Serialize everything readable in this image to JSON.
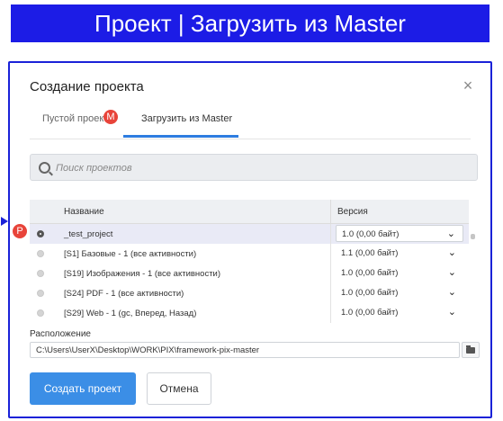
{
  "banner": {
    "title": "Проект | Загрузить из Master"
  },
  "dialog": {
    "title": "Создание проекта",
    "close_icon": "×",
    "tabs": [
      {
        "label": "Пустой проект",
        "active": false
      },
      {
        "label": "Загрузить из Master",
        "active": true,
        "marker": "M"
      }
    ],
    "search": {
      "placeholder": "Поиск проектов",
      "value": ""
    },
    "table": {
      "columns": [
        "Название",
        "Версия"
      ],
      "rows": [
        {
          "name": "_test_project",
          "version": "1.0 (0,00 байт)",
          "selected": true
        },
        {
          "name": "[S1] Базовые - 1 (все активности)",
          "version": "1.1 (0,00 байт)",
          "selected": false
        },
        {
          "name": "[S19] Изображения - 1 (все активности)",
          "version": "1.0 (0,00 байт)",
          "selected": false
        },
        {
          "name": "[S24] PDF - 1 (все активности)",
          "version": "1.0 (0,00 байт)",
          "selected": false
        },
        {
          "name": "[S29] Web - 1 (gc, Вперед, Назад)",
          "version": "1.0 (0,00 байт)",
          "selected": false
        }
      ],
      "chevron": "⌄",
      "row_marker": "P"
    },
    "location": {
      "label": "Расположение",
      "value": "C:\\Users\\UserX\\Desktop\\WORK\\PIX\\framework-pix-master"
    },
    "buttons": {
      "create": "Создать проект",
      "cancel": "Отмена"
    },
    "colors": {
      "accent": "#3b8ee6",
      "frame": "#1a22d8",
      "banner": "#1c1ce6",
      "marker": "#e8443a"
    }
  }
}
